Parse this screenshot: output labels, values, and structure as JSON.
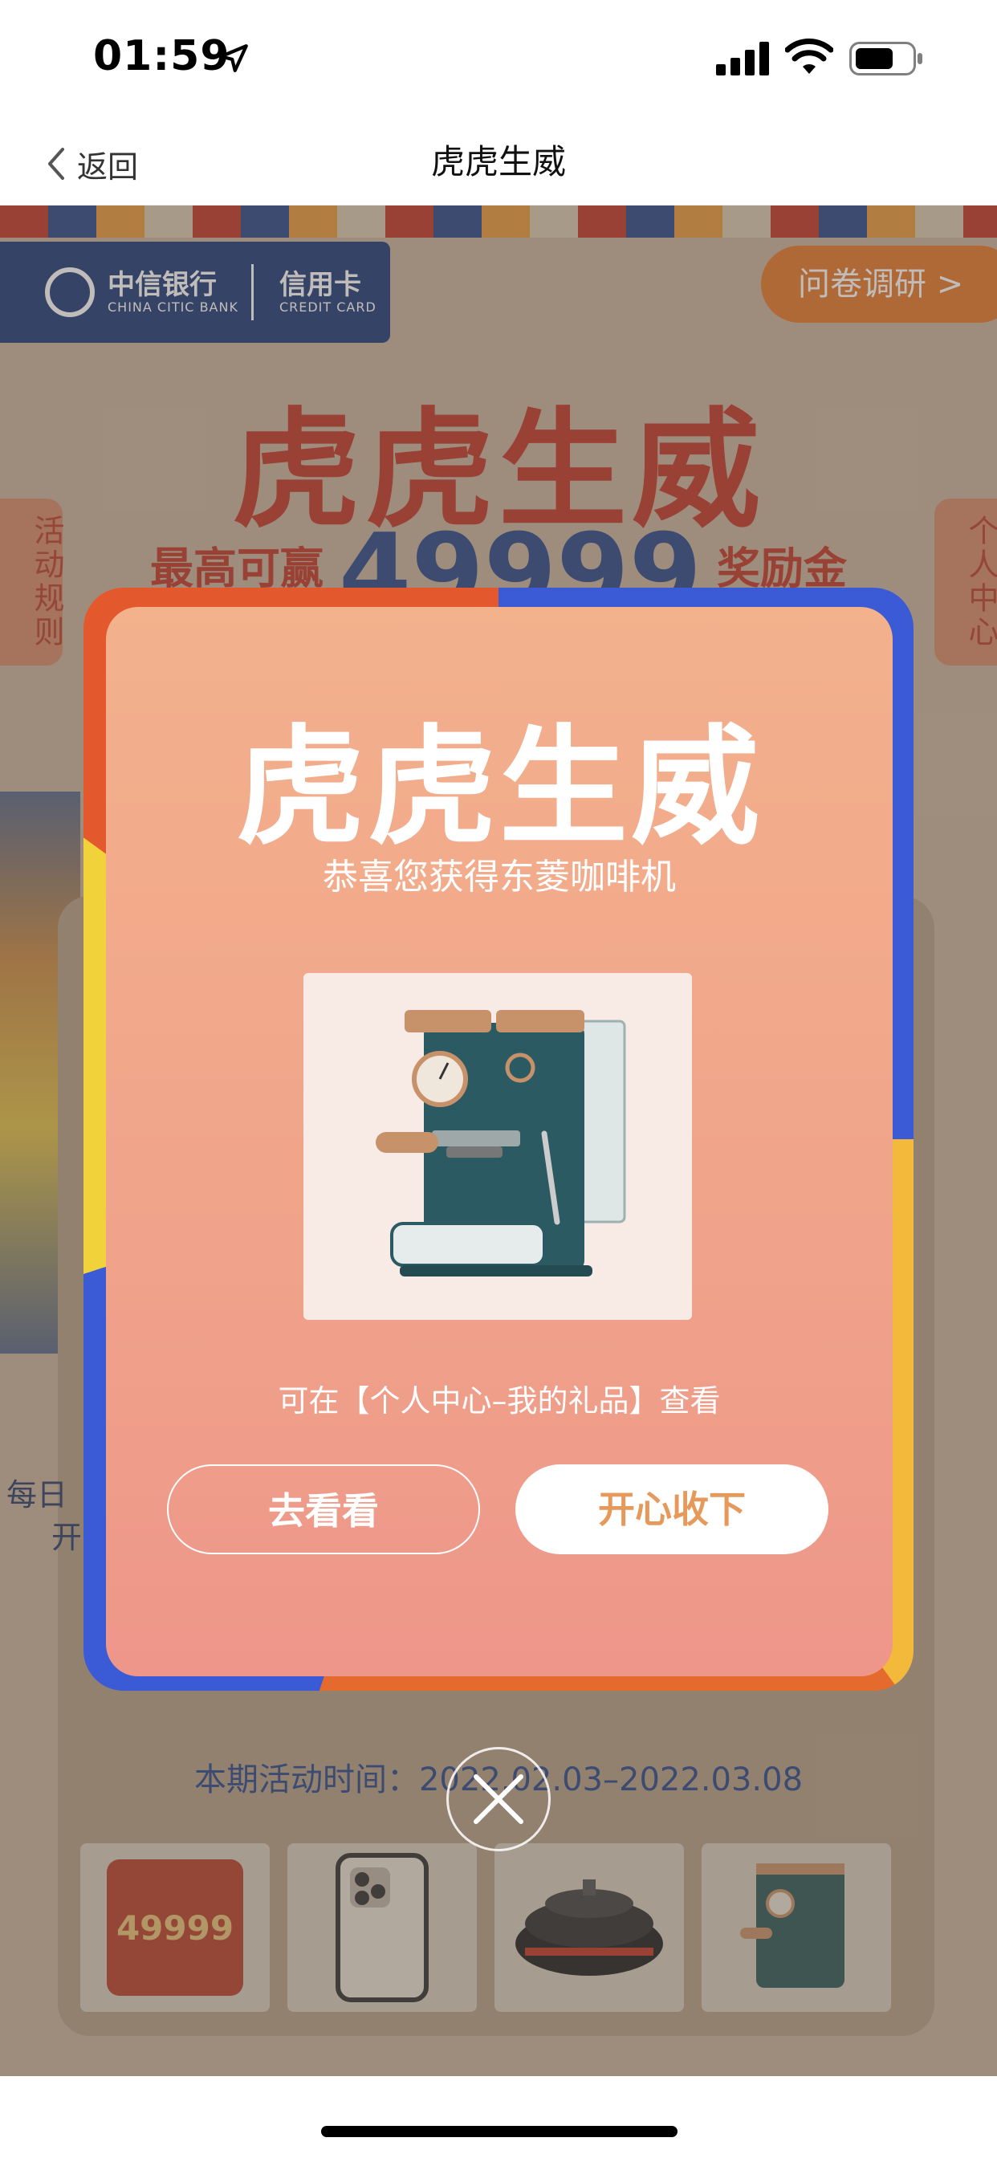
{
  "status_bar": {
    "time": "01:59",
    "icons": [
      "location-arrow-icon",
      "signal-icon",
      "wifi-icon",
      "battery-icon"
    ]
  },
  "nav": {
    "back_label": "返回",
    "title": "虎虎生威"
  },
  "background": {
    "bank_name": "中信银行",
    "bank_name_en": "CHINA CITIC BANK",
    "card_label": "信用卡",
    "card_label_en": "CREDIT CARD",
    "survey_label": "问卷调研 >",
    "title": "虎虎生威",
    "subtitle_prefix": "最高可赢",
    "subtitle_amount": "49999",
    "subtitle_suffix": "奖励金",
    "left_tab": "活动规则",
    "right_tab": "个人中心",
    "left_deco_text_1": "每日",
    "left_deco_text_2": "开",
    "period": "本期活动时间：2022.02.03–2022.03.08",
    "prizes": [
      {
        "name": "red-packet",
        "label": "49999"
      },
      {
        "name": "phone",
        "label": ""
      },
      {
        "name": "hot-pot",
        "label": ""
      },
      {
        "name": "coffee-machine",
        "label": ""
      }
    ]
  },
  "modal": {
    "title": "虎虎生威",
    "message": "恭喜您获得东菱咖啡机",
    "hint": "可在【个人中心–我的礼品】查看",
    "button_view": "去看看",
    "button_accept": "开心收下",
    "colors": {
      "gradient_top": "#f3b18c",
      "gradient_bottom": "#ee968a",
      "accept_text": "#e59a5c"
    }
  }
}
